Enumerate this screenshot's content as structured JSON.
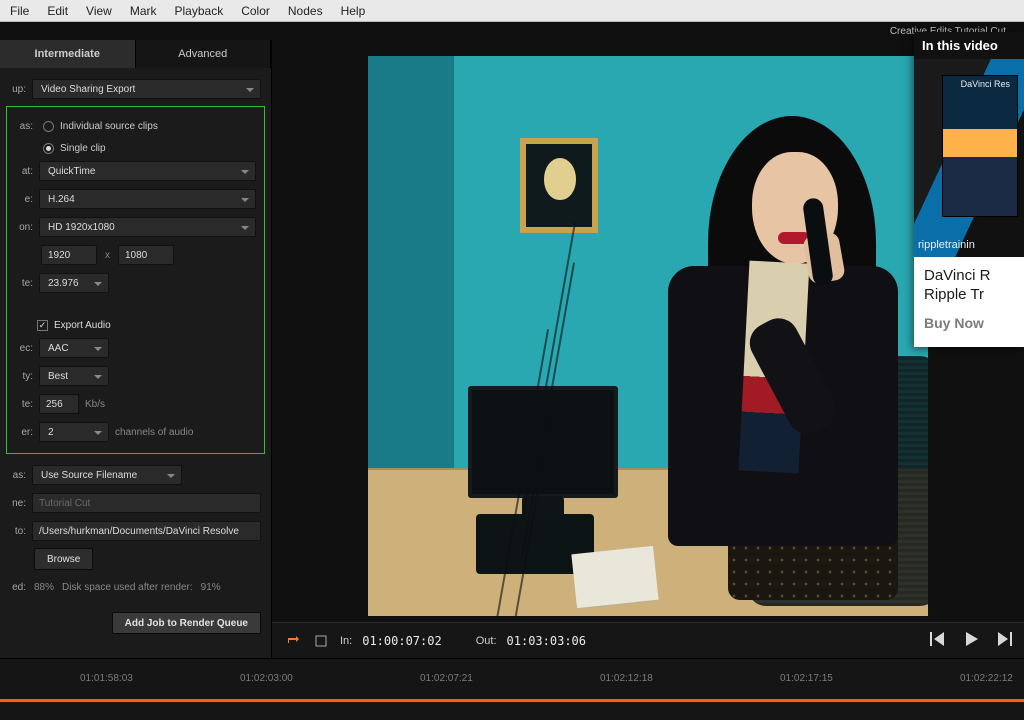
{
  "menubar": {
    "items": [
      "File",
      "Edit",
      "View",
      "Mark",
      "Playback",
      "Color",
      "Nodes",
      "Help"
    ]
  },
  "titlebar": {
    "project": "Creative Edits Tutorial Cut"
  },
  "left_panel": {
    "tabs": {
      "intermediate": "Intermediate",
      "advanced": "Advanced"
    },
    "group": {
      "label": "up:",
      "value": "Video Sharing Export"
    },
    "render": {
      "as_label": "as:",
      "option_individual": "Individual source clips",
      "option_single": "Single clip",
      "format": {
        "label": "at:",
        "value": "QuickTime"
      },
      "codec": {
        "label": "e:",
        "value": "H.264"
      },
      "resolution": {
        "label": "on:",
        "value": "HD 1920x1080",
        "w": "1920",
        "x": "x",
        "h": "1080"
      },
      "framerate": {
        "label": "te:",
        "value": "23.976"
      },
      "audio": {
        "export_audio": "Export Audio",
        "codec": {
          "label": "ec:",
          "value": "AAC"
        },
        "quality": {
          "label": "ty:",
          "value": "Best"
        },
        "bitrate": {
          "label": "te:",
          "value": "256",
          "unit": "Kb/s"
        },
        "channels": {
          "label": "er:",
          "value": "2",
          "suffix": "channels of audio"
        }
      }
    },
    "output": {
      "filename": {
        "label": "as:",
        "value": "Use Source Filename"
      },
      "custom_name": {
        "label": "ne:",
        "value": "Tutorial Cut"
      },
      "path": {
        "label": "to:",
        "value": "/Users/hurkman/Documents/DaVinci Resolve"
      },
      "browse": "Browse",
      "disk": {
        "label": "ed:",
        "used_pct": "88%",
        "text": "Disk space used after render:",
        "after_pct": "91%"
      }
    },
    "add_job": "Add Job to Render Queue"
  },
  "viewer": {
    "in_label": "In:",
    "in_tc": "01:00:07:02",
    "out_label": "Out:",
    "out_tc": "01:03:03:06"
  },
  "timeline": {
    "ticks": [
      "01:01:58:03",
      "01:02:03:00",
      "01:02:07:21",
      "01:02:12:18",
      "01:02:17:15",
      "01:02:22:12"
    ]
  },
  "card": {
    "header": "In this video",
    "brand": "rippletrainin",
    "box_top": "DaVinci Res",
    "title": "DaVinci R\nRipple Tr",
    "buy": "Buy Now"
  }
}
